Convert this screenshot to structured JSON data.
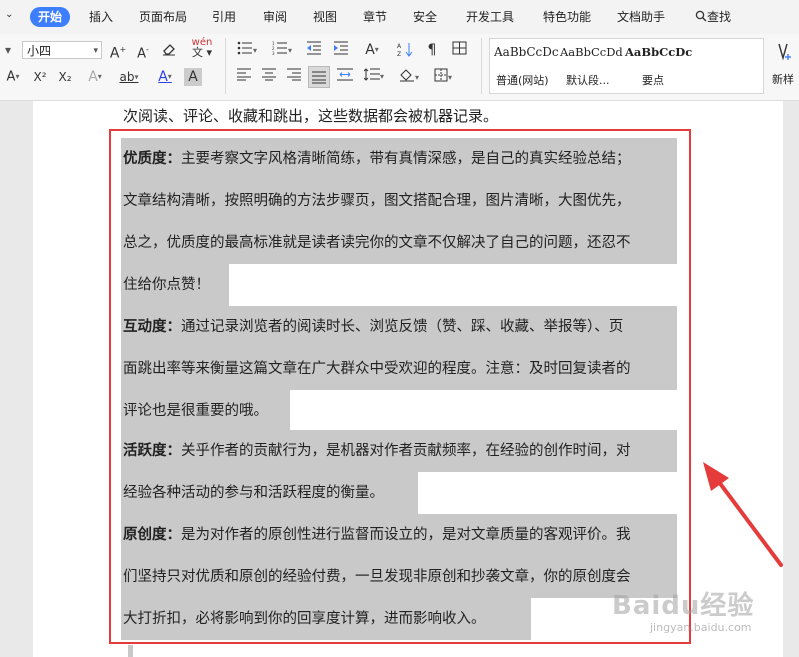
{
  "tabs": [
    {
      "label": "开始",
      "active": true
    },
    {
      "label": "插入"
    },
    {
      "label": "页面布局"
    },
    {
      "label": "引用"
    },
    {
      "label": "审阅"
    },
    {
      "label": "视图"
    },
    {
      "label": "章节"
    },
    {
      "label": "安全"
    },
    {
      "label": "开发工具"
    },
    {
      "label": "特色功能"
    },
    {
      "label": "文档助手"
    },
    {
      "label": "查找"
    }
  ],
  "ribbon": {
    "font_size": "小四",
    "grow_font": "A",
    "shrink_font": "A",
    "clear_format": "◇",
    "phonetic": "wén",
    "superscript": "X²",
    "subscript": "X₂",
    "font_effect": "A",
    "highlight": "ab",
    "font_color": "A",
    "char_shade": "A",
    "styles": [
      {
        "preview": "AaBbCcDc",
        "name": "普通(网站)"
      },
      {
        "preview": "AaBbCcDd",
        "name": "默认段..."
      },
      {
        "preview": "AaBbCcDc",
        "name": "要点"
      }
    ],
    "new_style": "新样"
  },
  "document": {
    "first_line": "次阅读、评论、收藏和跳出，这些数据都会被机器记录。",
    "lines": [
      {
        "bold": "优质度：",
        "text": "主要考察文字风格清晰简练，带有真情深感，是自己的真实经验总结；"
      },
      {
        "bold": "",
        "text": "文章结构清晰，按照明确的方法步骤页，图文搭配合理，图片清晰，大图优先，"
      },
      {
        "bold": "",
        "text": "总之，优质度的最高标准就是读者读完你的文章不仅解决了自己的问题，还忍不"
      },
      {
        "bold": "",
        "text": "住给你点赞！"
      },
      {
        "bold": "互动度：",
        "text": "通过记录浏览者的阅读时长、浏览反馈（赞、踩、收藏、举报等）、页"
      },
      {
        "bold": "",
        "text": "面跳出率等来衡量这篇文章在广大群众中受欢迎的程度。注意：及时回复读者的"
      },
      {
        "bold": "",
        "text": "评论也是很重要的哦。"
      },
      {
        "bold": "活跃度：",
        "text": "关乎作者的贡献行为，是机器对作者贡献频率，在经验的创作时间，对"
      },
      {
        "bold": "",
        "text": "经验各种活动的参与和活跃程度的衡量。"
      },
      {
        "bold": "原创度：",
        "text": "是为对作者的原创性进行监督而设立的，是对文章质量的客观评价。我"
      },
      {
        "bold": "",
        "text": "们坚持只对优质和原创的经验付费，一旦发现非原创和抄袭文章，你的原创度会"
      },
      {
        "bold": "",
        "text": "大打折扣，必将影响到你的回享度计算，进而影响收入。"
      }
    ]
  },
  "watermark": {
    "brand": "Baidu经验",
    "url": "jingyan.baidu.com"
  },
  "colors": {
    "accent": "#3d7eff",
    "annotation": "#e53b3b",
    "selection": "#c9c9c9"
  }
}
